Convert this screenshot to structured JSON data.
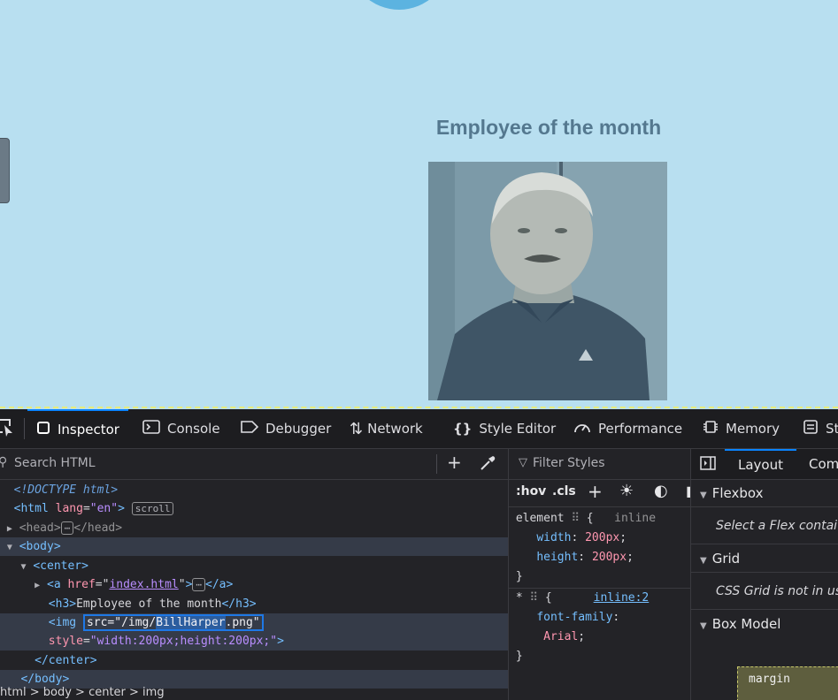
{
  "page": {
    "heading": "Employee of the month",
    "photo_alt": "Bill Harper"
  },
  "devtools": {
    "tabs": [
      {
        "label": "Inspector",
        "icon": "inspector-icon"
      },
      {
        "label": "Console",
        "icon": "console-icon"
      },
      {
        "label": "Debugger",
        "icon": "debugger-icon"
      },
      {
        "label": "Network",
        "icon": "network-icon"
      },
      {
        "label": "Style Editor",
        "icon": "style-editor-icon"
      },
      {
        "label": "Performance",
        "icon": "performance-icon"
      },
      {
        "label": "Memory",
        "icon": "memory-icon"
      },
      {
        "label": "St",
        "icon": "storage-icon"
      }
    ],
    "markup": {
      "search_placeholder": "Search HTML",
      "doctype": "<!DOCTYPE html>",
      "html_open": "<html",
      "html_attr": "lang",
      "html_attr_val": "\"en\"",
      "scroll_badge": "scroll",
      "head": "<head>",
      "head_close": "</head>",
      "body_open": "<body>",
      "center_open": "<center>",
      "a_open": "<a",
      "a_attr": "href",
      "a_href": "index.html",
      "a_close": "</a>",
      "h3_open": "<h3>",
      "h3_text": "Employee of the month",
      "h3_close": "</h3>",
      "img_open": "<img",
      "img_src_prefix": "src=\"/img/",
      "img_src_selected": "BillHarper",
      "img_src_suffix": ".png\"",
      "img_style_attr": "style",
      "img_style_val": "\"width:200px;height:200px;\"",
      "img_end": ">",
      "center_close": "</center>",
      "body_close": "</body>",
      "breadcrumbs": "html > body > center > img"
    },
    "rules": {
      "filter_placeholder": "Filter Styles",
      "hov": ":hov",
      "cls": ".cls",
      "element_selector": "element",
      "element_source": "inline",
      "width_prop": "width",
      "width_val": "200px",
      "height_prop": "height",
      "height_val": "200px",
      "star_selector": "*",
      "star_source": "inline:2",
      "font_prop": "font-family",
      "font_val": "Arial"
    },
    "layout": {
      "tab_layout": "Layout",
      "tab_computed": "Com",
      "flexbox_title": "Flexbox",
      "flexbox_msg": "Select a Flex contai",
      "grid_title": "Grid",
      "grid_msg": "CSS Grid is not in us",
      "boxmodel_title": "Box Model",
      "margin_label": "margin"
    }
  }
}
